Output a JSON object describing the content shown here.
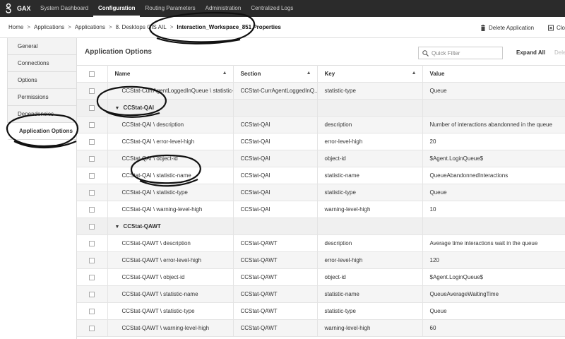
{
  "topnav": {
    "brand": "GAX",
    "items": [
      "System Dashboard",
      "Configuration",
      "Routing Parameters",
      "Administration",
      "Centralized Logs"
    ]
  },
  "breadcrumb": {
    "items": [
      "Home",
      "Applications",
      "Applications",
      "8. Desktops GIS AIL"
    ],
    "current": "Interaction_Workspace_851 Properties",
    "separator": ">"
  },
  "toolbar": {
    "delete_label": "Delete Application",
    "close_label": "Clo"
  },
  "sidebar": {
    "items": [
      "General",
      "Connections",
      "Options",
      "Permissions",
      "Dependencies",
      "Application Options"
    ]
  },
  "main": {
    "title": "Application Options",
    "filter_placeholder": "Quick Filter",
    "expand_all": "Expand All",
    "delete_label": "Delet"
  },
  "table": {
    "headers": {
      "name": "Name",
      "section": "Section",
      "key": "Key",
      "value": "Value"
    },
    "rows": [
      {
        "type": "row",
        "name": "CCStat-CurrAgentLoggedInQueue \\ statistic-...",
        "section": "CCStat-CurrAgentLoggedInQ...",
        "key": "statistic-type",
        "value": "Queue"
      },
      {
        "type": "group",
        "name": "CCStat-QAI"
      },
      {
        "type": "row",
        "name": "CCStat-QAI \\ description",
        "section": "CCStat-QAI",
        "key": "description",
        "value": "Number of interactions abandonned in the queue"
      },
      {
        "type": "row",
        "name": "CCStat-QAI \\ error-level-high",
        "section": "CCStat-QAI",
        "key": "error-level-high",
        "value": "20"
      },
      {
        "type": "row",
        "name": "CCStat-QAI \\ object-id",
        "section": "CCStat-QAI",
        "key": "object-id",
        "value": "$Agent.LoginQueue$"
      },
      {
        "type": "row",
        "name": "CCStat-QAI \\ statistic-name",
        "section": "CCStat-QAI",
        "key": "statistic-name",
        "value": "QueueAbandonnedInteractions"
      },
      {
        "type": "row",
        "name": "CCStat-QAI \\ statistic-type",
        "section": "CCStat-QAI",
        "key": "statistic-type",
        "value": "Queue"
      },
      {
        "type": "row",
        "name": "CCStat-QAI \\ warning-level-high",
        "section": "CCStat-QAI",
        "key": "warning-level-high",
        "value": "10"
      },
      {
        "type": "group",
        "name": "CCStat-QAWT"
      },
      {
        "type": "row",
        "name": "CCStat-QAWT \\ description",
        "section": "CCStat-QAWT",
        "key": "description",
        "value": "Average time interactions wait in the queue"
      },
      {
        "type": "row",
        "name": "CCStat-QAWT \\ error-level-high",
        "section": "CCStat-QAWT",
        "key": "error-level-high",
        "value": "120"
      },
      {
        "type": "row",
        "name": "CCStat-QAWT \\ object-id",
        "section": "CCStat-QAWT",
        "key": "object-id",
        "value": "$Agent.LoginQueue$"
      },
      {
        "type": "row",
        "name": "CCStat-QAWT \\ statistic-name",
        "section": "CCStat-QAWT",
        "key": "statistic-name",
        "value": "QueueAverageWaitingTime"
      },
      {
        "type": "row",
        "name": "CCStat-QAWT \\ statistic-type",
        "section": "CCStat-QAWT",
        "key": "statistic-type",
        "value": "Queue"
      },
      {
        "type": "row",
        "name": "CCStat-QAWT \\ warning-level-high",
        "section": "CCStat-QAWT",
        "key": "warning-level-high",
        "value": "60"
      }
    ]
  }
}
